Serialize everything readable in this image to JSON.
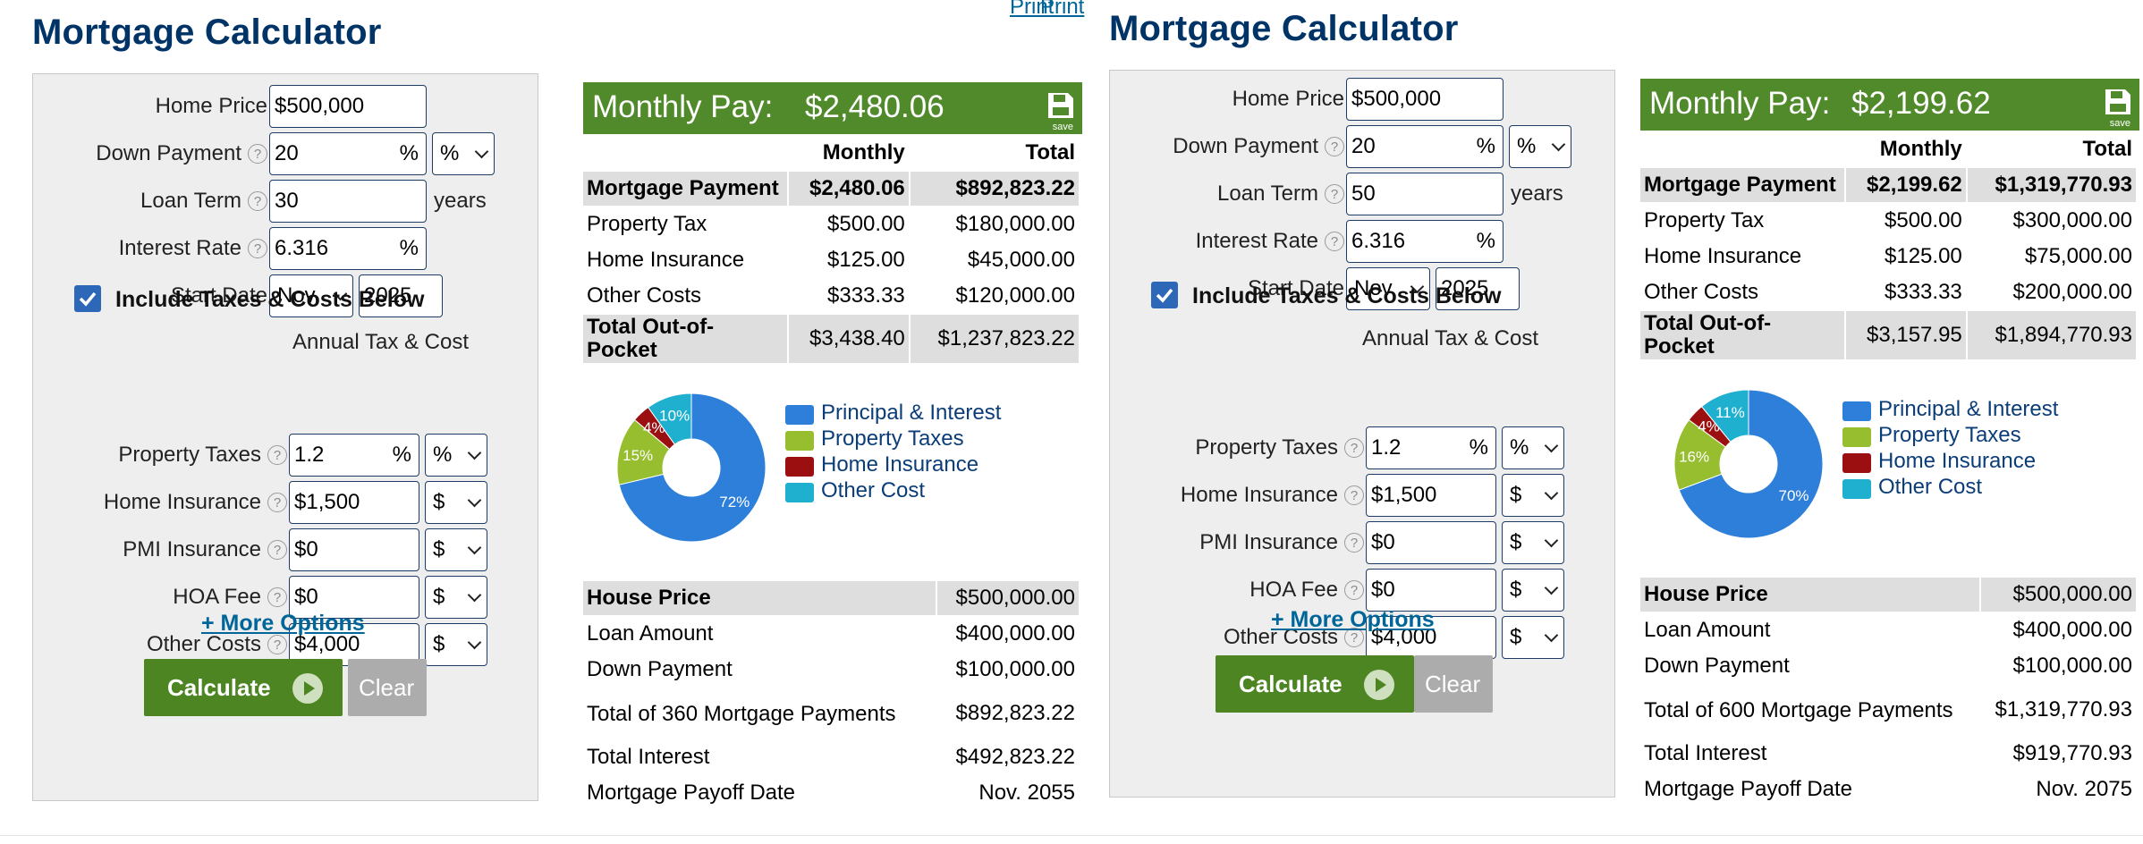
{
  "calculators": [
    {
      "print_label": "Print",
      "title": "Mortgage Calculator",
      "form": {
        "home_price_label": "Home Price",
        "home_price_value": "$500,000",
        "down_payment_label": "Down Payment",
        "down_payment_value": "20",
        "down_payment_suffix": "%",
        "down_payment_unit": "%",
        "loan_term_label": "Loan Term",
        "loan_term_value": "30",
        "loan_term_unit": "years",
        "interest_rate_label": "Interest Rate",
        "interest_rate_value": "6.316",
        "interest_rate_suffix": "%",
        "start_date_label": "Start Date",
        "start_month": "Nov",
        "start_year": "2025",
        "include_label": "Include Taxes & Costs Below",
        "include_checked": true,
        "annual_header": "Annual Tax & Cost",
        "property_taxes_label": "Property Taxes",
        "property_taxes_value": "1.2",
        "property_taxes_suffix": "%",
        "property_taxes_unit": "%",
        "home_insurance_label": "Home Insurance",
        "home_insurance_value": "$1,500",
        "home_insurance_unit": "$",
        "pmi_label": "PMI Insurance",
        "pmi_value": "$0",
        "pmi_unit": "$",
        "hoa_label": "HOA Fee",
        "hoa_value": "$0",
        "hoa_unit": "$",
        "other_costs_label": "Other Costs",
        "other_costs_value": "$4,000",
        "other_costs_unit": "$",
        "more_options": "+ More Options",
        "calculate": "Calculate",
        "clear": "Clear",
        "help_glyph": "?"
      },
      "results": {
        "monthly_pay_label": "Monthly Pay:",
        "monthly_pay_value": "$2,480.06",
        "save_label": "save",
        "col_monthly": "Monthly",
        "col_total": "Total",
        "rows": [
          {
            "label": "Mortgage Payment",
            "monthly": "$2,480.06",
            "total": "$892,823.22"
          },
          {
            "label": "Property Tax",
            "monthly": "$500.00",
            "total": "$180,000.00"
          },
          {
            "label": "Home Insurance",
            "monthly": "$125.00",
            "total": "$45,000.00"
          },
          {
            "label": "Other Costs",
            "monthly": "$333.33",
            "total": "$120,000.00"
          },
          {
            "label": "Total Out-of-Pocket",
            "monthly": "$3,438.40",
            "total": "$1,237,823.22"
          }
        ]
      },
      "chart_data": {
        "type": "pie",
        "series": [
          {
            "name": "Principal & Interest",
            "value": 72,
            "label": "72%",
            "color": "#2e7fd9"
          },
          {
            "name": "Property Taxes",
            "value": 15,
            "label": "15%",
            "color": "#96be2e"
          },
          {
            "name": "Home Insurance",
            "value": 4,
            "label": "4%",
            "color": "#9c0f10"
          },
          {
            "name": "Other Cost",
            "value": 10,
            "label": "10%",
            "color": "#1fb0cf"
          }
        ]
      },
      "summary": [
        {
          "label": "House Price",
          "value": "$500,000.00"
        },
        {
          "label": "Loan Amount",
          "value": "$400,000.00"
        },
        {
          "label": "Down Payment",
          "value": "$100,000.00"
        },
        {
          "label": "Total of 360 Mortgage Payments",
          "value": "$892,823.22"
        },
        {
          "label": "Total Interest",
          "value": "$492,823.22"
        },
        {
          "label": "Mortgage Payoff Date",
          "value": "Nov. 2055"
        }
      ]
    },
    {
      "print_label": "Print",
      "title": "Mortgage Calculator",
      "form": {
        "home_price_label": "Home Price",
        "home_price_value": "$500,000",
        "down_payment_label": "Down Payment",
        "down_payment_value": "20",
        "down_payment_suffix": "%",
        "down_payment_unit": "%",
        "loan_term_label": "Loan Term",
        "loan_term_value": "50",
        "loan_term_unit": "years",
        "interest_rate_label": "Interest Rate",
        "interest_rate_value": "6.316",
        "interest_rate_suffix": "%",
        "start_date_label": "Start Date",
        "start_month": "Nov",
        "start_year": "2025",
        "include_label": "Include Taxes & Costs Below",
        "include_checked": true,
        "annual_header": "Annual Tax & Cost",
        "property_taxes_label": "Property Taxes",
        "property_taxes_value": "1.2",
        "property_taxes_suffix": "%",
        "property_taxes_unit": "%",
        "home_insurance_label": "Home Insurance",
        "home_insurance_value": "$1,500",
        "home_insurance_unit": "$",
        "pmi_label": "PMI Insurance",
        "pmi_value": "$0",
        "pmi_unit": "$",
        "hoa_label": "HOA Fee",
        "hoa_value": "$0",
        "hoa_unit": "$",
        "other_costs_label": "Other Costs",
        "other_costs_value": "$4,000",
        "other_costs_unit": "$",
        "more_options": "+ More Options",
        "calculate": "Calculate",
        "clear": "Clear",
        "help_glyph": "?"
      },
      "results": {
        "monthly_pay_label": "Monthly Pay:",
        "monthly_pay_value": "$2,199.62",
        "save_label": "save",
        "col_monthly": "Monthly",
        "col_total": "Total",
        "rows": [
          {
            "label": "Mortgage Payment",
            "monthly": "$2,199.62",
            "total": "$1,319,770.93"
          },
          {
            "label": "Property Tax",
            "monthly": "$500.00",
            "total": "$300,000.00"
          },
          {
            "label": "Home Insurance",
            "monthly": "$125.00",
            "total": "$75,000.00"
          },
          {
            "label": "Other Costs",
            "monthly": "$333.33",
            "total": "$200,000.00"
          },
          {
            "label": "Total Out-of-Pocket",
            "monthly": "$3,157.95",
            "total": "$1,894,770.93"
          }
        ]
      },
      "chart_data": {
        "type": "pie",
        "series": [
          {
            "name": "Principal & Interest",
            "value": 70,
            "label": "70%",
            "color": "#2e7fd9"
          },
          {
            "name": "Property Taxes",
            "value": 16,
            "label": "16%",
            "color": "#96be2e"
          },
          {
            "name": "Home Insurance",
            "value": 4,
            "label": "4%",
            "color": "#9c0f10"
          },
          {
            "name": "Other Cost",
            "value": 11,
            "label": "11%",
            "color": "#1fb0cf"
          }
        ]
      },
      "summary": [
        {
          "label": "House Price",
          "value": "$500,000.00"
        },
        {
          "label": "Loan Amount",
          "value": "$400,000.00"
        },
        {
          "label": "Down Payment",
          "value": "$100,000.00"
        },
        {
          "label": "Total of 600 Mortgage Payments",
          "value": "$1,319,770.93"
        },
        {
          "label": "Total Interest",
          "value": "$919,770.93"
        },
        {
          "label": "Mortgage Payoff Date",
          "value": "Nov. 2075"
        }
      ]
    }
  ]
}
